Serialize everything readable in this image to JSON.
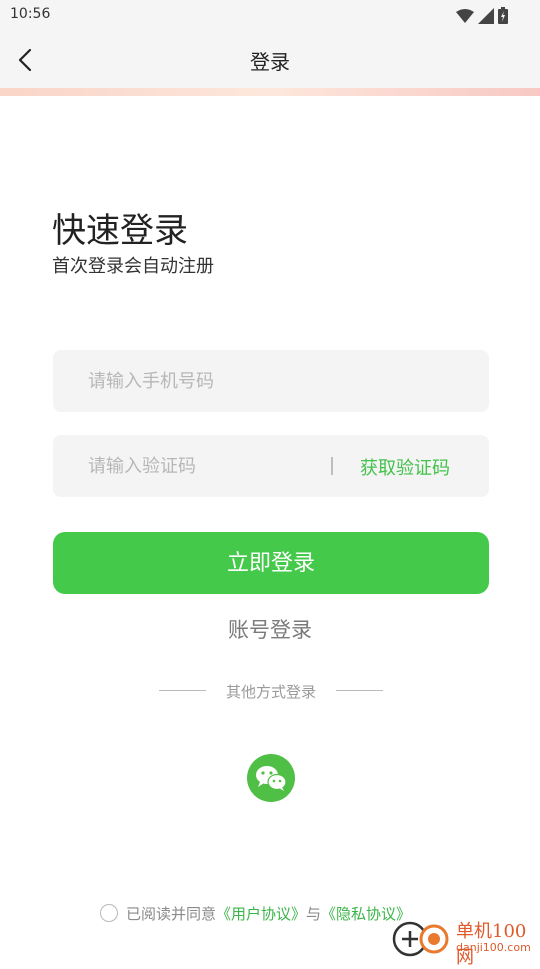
{
  "status_bar": {
    "time": "10:56",
    "icons": [
      "wifi-icon",
      "signal-icon",
      "battery-icon"
    ]
  },
  "nav": {
    "title": "登录",
    "back_icon": "chevron-left-icon"
  },
  "main": {
    "heading": "快速登录",
    "subheading": "首次登录会自动注册",
    "phone_placeholder": "请输入手机号码",
    "code_placeholder": "请输入验证码",
    "get_code_label": "获取验证码",
    "login_button_label": "立即登录",
    "account_login_label": "账号登录",
    "other_methods_label": "其他方式登录",
    "wechat_icon": "wechat-icon"
  },
  "agreement": {
    "prefix": "已阅读并同意",
    "user_agreement": "《用户协议》",
    "connector": "与",
    "privacy_policy": "《隐私协议》"
  },
  "watermark": {
    "title": "单机100网",
    "url": "danji100.com"
  },
  "colors": {
    "accent_green": "#44c94a",
    "link_green": "#3bb54a",
    "watermark_orange": "#e05a2b"
  }
}
